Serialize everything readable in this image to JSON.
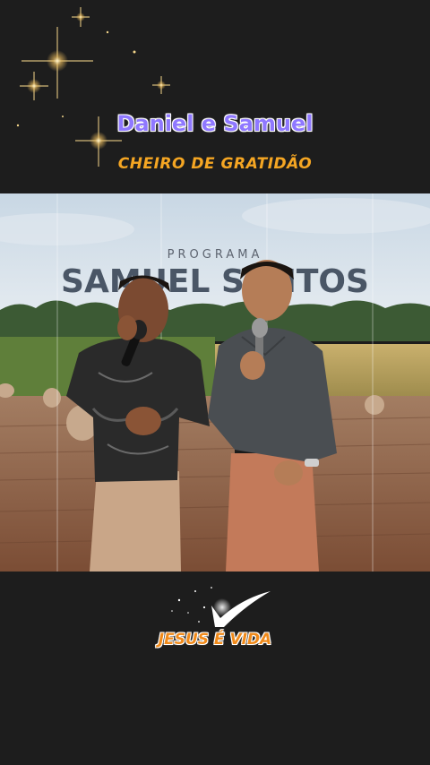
{
  "header": {
    "artist": "Daniel e Samuel",
    "song_title": "CHEIRO DE GRATIDÃO"
  },
  "video": {
    "backdrop_small_text": "PROGRAMA",
    "backdrop_big_text": "SAMUEL SANTOS"
  },
  "footer": {
    "channel_logo_text": "JESUS É VIDA",
    "logo_icon": "checkmark-swoosh-icon"
  },
  "colors": {
    "background": "#1d1d1d",
    "artist_text": "#8f78ff",
    "song_text": "#f5a623",
    "logo_text": "#f08a1a"
  }
}
